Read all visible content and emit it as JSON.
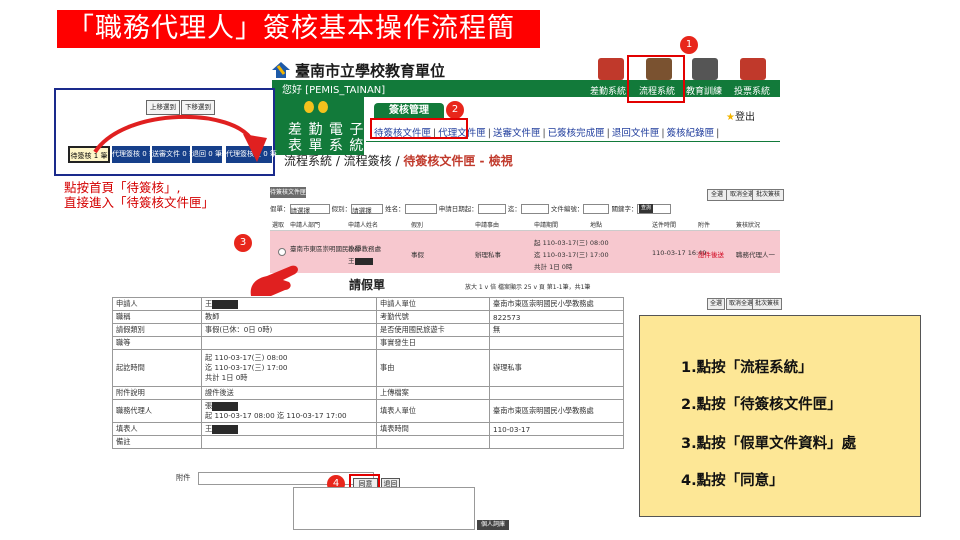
{
  "slide": {
    "title": "「職務代理人」簽核基本操作流程簡介"
  },
  "header": {
    "school_name": "臺南市立學校教育單位",
    "greeting": "您好 [PEMIS_TAINAN]",
    "top_icons": [
      {
        "label": "差勤系統",
        "icon": "attendance-icon",
        "color": "#c0392b"
      },
      {
        "label": "流程系統",
        "icon": "workflow-icon",
        "color": "#7a5230"
      },
      {
        "label": "教育訓練",
        "icon": "training-icon",
        "color": "#555555"
      },
      {
        "label": "投票系統",
        "icon": "vote-icon",
        "color": "#c0392b"
      }
    ],
    "app_logo": {
      "line1": "差 勤 電 子",
      "line2": "表 單 系 統"
    },
    "mgmt_tab": "簽核管理",
    "logout": "登出",
    "nav": [
      "待簽核文件匣",
      "代理文件匣",
      "送審文件匣",
      "已簽核完成匣",
      "退回文件匣",
      "簽核紀錄匣"
    ],
    "breadcrumb_prefix": "流程系統 / 流程簽核 / ",
    "breadcrumb_current": "待簽核文件匣 - 檢視"
  },
  "inset": {
    "buttons": [
      "上移選到",
      "下移選到"
    ],
    "tabs": [
      "待簽核 1 筆",
      "代理簽核 0 筆",
      "送審文件 0 筆",
      "退回 0 筆",
      "代理簽核匣 0 筆"
    ]
  },
  "hint": {
    "line1": "點按首頁「待簽核」,",
    "line2": "直接進入「待簽核文件匣」"
  },
  "list": {
    "folder_label": "待簽核文件匣",
    "buttons": [
      "全選",
      "取消全選",
      "批次簽核"
    ],
    "filters": [
      "假單：",
      "請選擇",
      "假別：",
      "請選擇",
      "姓名：",
      "申請日期起：",
      "迄：",
      "文件編號：",
      "關鍵字："
    ],
    "go": "查詢",
    "headers": [
      "選取",
      "申請人部門",
      "申請人姓名",
      "假別",
      "申請事由",
      "申請期間",
      "地點",
      "送件時間",
      "附件",
      "簽核狀況"
    ],
    "row": {
      "dept": "臺南市東區崇明國民小學教務處",
      "name_title": "教師",
      "name": "王",
      "type": "事假",
      "reason": "辦理私事",
      "period1": "起 110-03-17(三) 08:00",
      "period2": "迄 110-03-17(三) 17:00",
      "period3": "共計 1日 0時",
      "sent": "110-03-17 16:49",
      "attach": "證件後送",
      "status": "職務代理人一"
    }
  },
  "form": {
    "title": "請假單",
    "tools": "放大 1 v 倍   檔案顯示 25 v 頁  第1-1筆，共1筆",
    "right_buttons": [
      "全選",
      "取消全選",
      "批次簽核"
    ],
    "rows": [
      {
        "l1": "申請人",
        "v1": "王",
        "l2": "申請人單位",
        "v2": "臺南市東區崇明國民小學教務處"
      },
      {
        "l1": "職稱",
        "v1": "教師",
        "l2": "考勤代號",
        "v2": "822573"
      },
      {
        "l1": "請假類別",
        "v1": "事假(已休：0日 0時)",
        "l2": "是否使用國民旅遊卡",
        "v2": "無"
      },
      {
        "l1": "職等",
        "v1": "",
        "l2": "事實發生日",
        "v2": ""
      },
      {
        "l1": "起訖時間",
        "v1a": "起 110-03-17(三) 08:00",
        "v1b": "迄 110-03-17(三) 17:00",
        "v1c": "共計 1日 0時",
        "l2": "事由",
        "v2": "辦理私事"
      },
      {
        "l1": "附件說明",
        "v1": "證件後送",
        "l2": "上傳檔案",
        "v2": ""
      },
      {
        "l1": "職務代理人",
        "v1a": "張",
        "v1b": "起 110-03-17 08:00 迄 110-03-17 17:00",
        "l2": "填表人單位",
        "v2": "臺南市東區崇明國民小學教務處"
      },
      {
        "l1": "填表人",
        "v1": "王",
        "l2": "填表時間",
        "v2": "110-03-17"
      },
      {
        "l1": "備註",
        "v1": "",
        "l2": "",
        "v2": ""
      }
    ],
    "attach_label": "附件",
    "agree": "同意",
    "back": "退回",
    "phrase": "個人詞庫"
  },
  "markers": [
    "1",
    "2",
    "3",
    "4"
  ],
  "steps": [
    "1.點按「流程系統」",
    "2.點按「待簽核文件匣」",
    "3.點按「假單文件資料」處",
    "4.點按「同意」"
  ]
}
